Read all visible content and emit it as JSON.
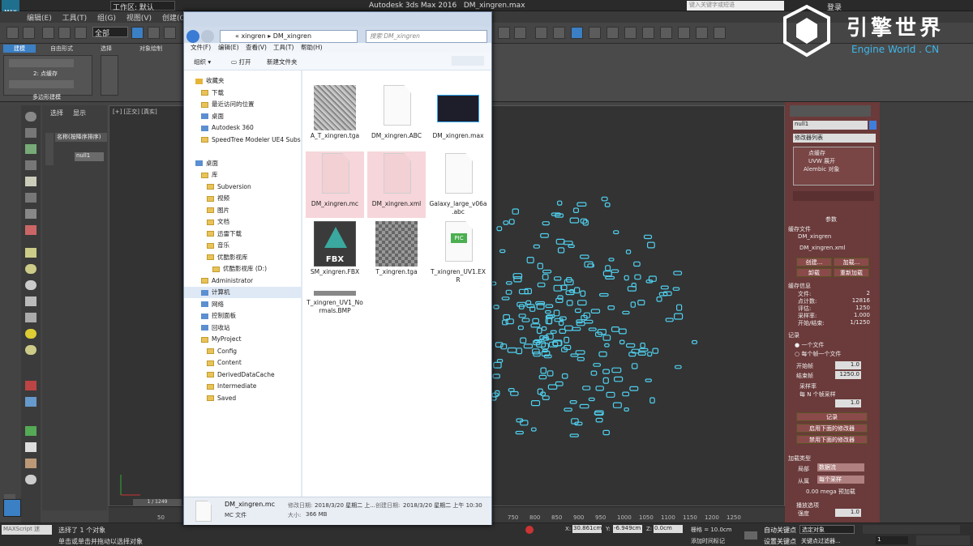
{
  "app": {
    "title": "Autodesk 3ds Max 2016",
    "document": "DM_xingren.max",
    "workspace_label": "工作区: 默认",
    "search_placeholder": "键入关键字或短语",
    "login": "登录"
  },
  "menu": [
    "编辑(E)",
    "工具(T)",
    "组(G)",
    "视图(V)",
    "创建(C)"
  ],
  "toolbar": {
    "selection_filter": "全部"
  },
  "ribbon": {
    "tabs": [
      "建模",
      "自由形式",
      "选择",
      "对象绘制"
    ],
    "sub_label": "2: 点缓存",
    "group_label": "多边形建模"
  },
  "scene_explorer": {
    "tabs": [
      "选择",
      "显示"
    ],
    "header": "名称(按降序排序)",
    "node": "null1"
  },
  "viewport": {
    "label": "[+] [正交] [真实]"
  },
  "logo": {
    "cn": "引擎世界",
    "en": "Engine World . CN"
  },
  "right_panel": {
    "object_name": "null1",
    "modifier_list": "修改器列表",
    "stack": [
      "点缓存",
      "UVW 展开",
      "Alembic 对象"
    ],
    "params_title": "参数",
    "cache_file_label": "缓存文件",
    "cache_name": "DM_xingren",
    "cache_path": "DM_xingren.xml",
    "buttons": [
      "创建...",
      "加载...",
      "卸载",
      "重新加载"
    ],
    "info_title": "缓存信息",
    "info": [
      {
        "k": "文件:",
        "v": "2"
      },
      {
        "k": "点计数:",
        "v": "12816"
      },
      {
        "k": "评估:",
        "v": "1250"
      },
      {
        "k": "采样率:",
        "v": "1.000"
      },
      {
        "k": "开始/结束:",
        "v": "1/1250"
      }
    ],
    "record_title": "记录",
    "record_opts": [
      "一个文件",
      "每个帧一个文件"
    ],
    "start_frame_label": "开始帧",
    "start_frame": "1.0",
    "end_frame_label": "结束帧",
    "end_frame": "1250.0",
    "sample_label": "采样率",
    "per_n_frames": "每 N 个帧采样",
    "sample_value": "1.0",
    "record_button": "记录",
    "enable_button": "启用下面的修改器",
    "disable_button": "禁用下面的修改器",
    "load_type": "加载类型",
    "local_label": "局部",
    "local_value": "数据流",
    "from_label": "从属",
    "from_value": "每个采样",
    "mem_note": "0.00 mega 预加载",
    "playback_title": "播放选项",
    "strength_label": "强度",
    "strength_value": "1.0"
  },
  "timeline": {
    "frame": "1 / 1249",
    "ticks": [
      "50",
      "750",
      "800",
      "850",
      "900",
      "950",
      "1000",
      "1050",
      "1100",
      "1150",
      "1200",
      "1250"
    ]
  },
  "status": {
    "maxscript": "MAXScript 迷",
    "line1": "选择了 1 个对象",
    "line2": "单击或单击并拖动以选择对象",
    "x_label": "X:",
    "x": "30.861cm",
    "y_label": "Y:",
    "y": "-6.949cm",
    "z_label": "Z:",
    "z": "0.0cm",
    "grid": "栅格 = 10.0cm",
    "add_tag": "添加时间标记",
    "autokey": "自动关键点",
    "setkey": "设置关键点",
    "selected": "选定对象",
    "filter": "关键点过滤器...",
    "frame_field": "1"
  },
  "explorer": {
    "path": [
      "xingren",
      "DM_xingren"
    ],
    "search_placeholder": "搜索 DM_xingren",
    "menu": [
      "文件(F)",
      "编辑(E)",
      "查看(V)",
      "工具(T)",
      "帮助(H)"
    ],
    "cmd": [
      "组织 ▾",
      "打开",
      "新建文件夹"
    ],
    "tree": [
      {
        "label": "收藏夹",
        "level": 0,
        "type": "star"
      },
      {
        "label": "下载",
        "level": 1,
        "type": "folder"
      },
      {
        "label": "最近访问的位置",
        "level": 1,
        "type": "folder"
      },
      {
        "label": "桌面",
        "level": 1,
        "type": "blue"
      },
      {
        "label": "Autodesk 360",
        "level": 1,
        "type": "blue"
      },
      {
        "label": "SpeedTree Modeler UE4 Subs",
        "level": 1,
        "type": "folder"
      },
      {
        "label": "",
        "level": 0,
        "type": "none"
      },
      {
        "label": "桌面",
        "level": 0,
        "type": "blue"
      },
      {
        "label": "库",
        "level": 1,
        "type": "folder"
      },
      {
        "label": "Subversion",
        "level": 2,
        "type": "folder"
      },
      {
        "label": "视频",
        "level": 2,
        "type": "folder"
      },
      {
        "label": "图片",
        "level": 2,
        "type": "folder"
      },
      {
        "label": "文档",
        "level": 2,
        "type": "folder"
      },
      {
        "label": "迅雷下载",
        "level": 2,
        "type": "folder"
      },
      {
        "label": "音乐",
        "level": 2,
        "type": "folder"
      },
      {
        "label": "优酷影视库",
        "level": 2,
        "type": "folder"
      },
      {
        "label": "优酷影视库 (D:)",
        "level": 3,
        "type": "folder"
      },
      {
        "label": "Administrator",
        "level": 1,
        "type": "folder"
      },
      {
        "label": "计算机",
        "level": 1,
        "type": "blue"
      },
      {
        "label": "网络",
        "level": 1,
        "type": "blue"
      },
      {
        "label": "控制面板",
        "level": 1,
        "type": "blue"
      },
      {
        "label": "回收站",
        "level": 1,
        "type": "blue"
      },
      {
        "label": "MyProject",
        "level": 1,
        "type": "folder"
      },
      {
        "label": "Config",
        "level": 2,
        "type": "folder"
      },
      {
        "label": "Content",
        "level": 2,
        "type": "folder"
      },
      {
        "label": "DerivedDataCache",
        "level": 2,
        "type": "folder"
      },
      {
        "label": "Intermediate",
        "level": 2,
        "type": "folder"
      },
      {
        "label": "Saved",
        "level": 2,
        "type": "folder"
      }
    ],
    "files": [
      {
        "name": "A_T_xingren.tga",
        "kind": "noise"
      },
      {
        "name": "DM_xingren.ABC",
        "kind": "doc"
      },
      {
        "name": "DM_xingren.max",
        "kind": "max"
      },
      {
        "name": "DM_xingren.mc",
        "kind": "docsel"
      },
      {
        "name": "DM_xingren.xml",
        "kind": "docsel"
      },
      {
        "name": "Galaxy_large_v06a.abc",
        "kind": "doc"
      },
      {
        "name": "SM_xingren.FBX",
        "kind": "fbx"
      },
      {
        "name": "T_xingren.tga",
        "kind": "checker"
      },
      {
        "name": "T_xingren_UV1.EXR",
        "kind": "pic"
      },
      {
        "name": "T_xingren_UV1_Normals.BMP",
        "kind": "bar"
      }
    ],
    "fbx_label": "FBX",
    "pic_label": "PIC",
    "details": {
      "name": "DM_xingren.mc",
      "type": "MC 文件",
      "modified_label": "修改日期:",
      "modified": "2018/3/20 星期二 上...",
      "size_label": "大小:",
      "size": "366 MB",
      "created_label": "创建日期:",
      "created": "2018/3/20 星期二 上午 10:30"
    }
  }
}
